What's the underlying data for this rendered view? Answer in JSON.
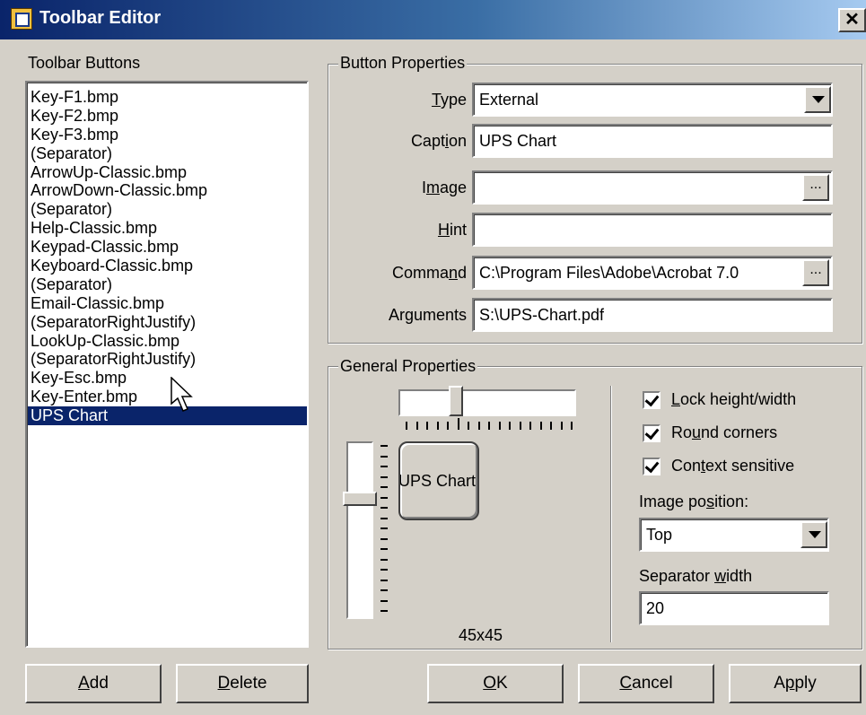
{
  "window": {
    "title": "Toolbar Editor",
    "close_glyph": "✕"
  },
  "toolbar_buttons": {
    "label": "Toolbar Buttons",
    "items": [
      "Key-F1.bmp",
      "Key-F2.bmp",
      "Key-F3.bmp",
      "(Separator)",
      "ArrowUp-Classic.bmp",
      "ArrowDown-Classic.bmp",
      "(Separator)",
      "Help-Classic.bmp",
      "Keypad-Classic.bmp",
      "Keyboard-Classic.bmp",
      "(Separator)",
      "Email-Classic.bmp",
      "(SeparatorRightJustify)",
      "LookUp-Classic.bmp",
      "(SeparatorRightJustify)",
      "Key-Esc.bmp",
      "Key-Enter.bmp",
      "UPS Chart"
    ],
    "selected": "UPS Chart",
    "add_label": "Add",
    "delete_label": "Delete"
  },
  "button_properties": {
    "title": "Button Properties",
    "type_label": "Type",
    "type_value": "External",
    "caption_label": "Caption",
    "caption_value": "UPS Chart",
    "image_label": "Image",
    "image_value": "",
    "hint_label": "Hint",
    "hint_value": "",
    "command_label": "Command",
    "command_value": "C:\\Program Files\\Adobe\\Acrobat 7.0",
    "arguments_label": "Arguments",
    "arguments_value": "S:\\UPS-Chart.pdf",
    "ellipsis": "..."
  },
  "general_properties": {
    "title": "General Properties",
    "preview_caption": "UPS Chart",
    "size_label": "45x45",
    "lock_label": "Lock height/width",
    "lock_checked": true,
    "round_label": "Round corners",
    "round_checked": true,
    "context_label": "Context sensitive",
    "context_checked": true,
    "image_position_label": "Image position:",
    "image_position_value": "Top",
    "separator_width_label": "Separator width",
    "separator_width_value": "20"
  },
  "footer": {
    "ok_label": "OK",
    "cancel_label": "Cancel",
    "apply_label": "Apply"
  }
}
